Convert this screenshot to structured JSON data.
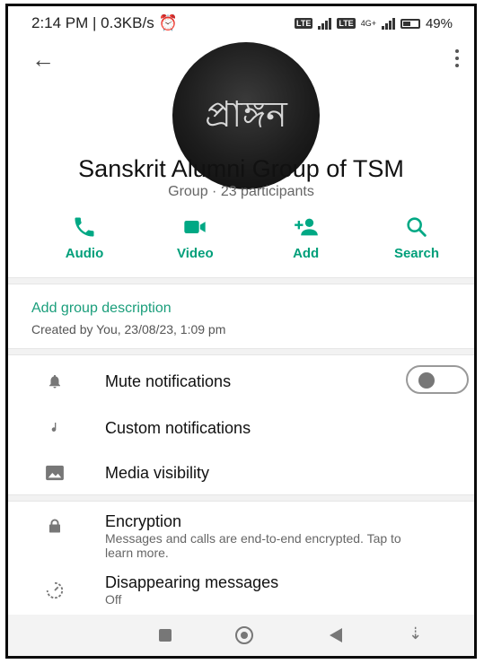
{
  "status": {
    "time_speed": "2:14 PM | 0.3KB/s",
    "network_label": "4G+",
    "battery": "49"
  },
  "group": {
    "avatar_text": "প্রাঙ্গন",
    "name": "Sanskrit Alumni Group of TSM",
    "meta": "Group · 23 participants"
  },
  "actions": [
    {
      "label": "Audio"
    },
    {
      "label": "Video"
    },
    {
      "label": "Add"
    },
    {
      "label": "Search"
    }
  ],
  "description": {
    "add_label": "Add group description",
    "created": "Created by You, 23/08/23, 1:09 pm"
  },
  "settings": {
    "mute": "Mute notifications",
    "custom": "Custom notifications",
    "media": "Media visibility",
    "encryption_title": "Encryption",
    "encryption_sub": "Messages and calls are end-to-end encrypted. Tap to learn more.",
    "disappearing_title": "Disappearing messages",
    "disappearing_sub": "Off"
  },
  "colors": {
    "accent": "#00a884",
    "accent_text": "#1a9e7b"
  },
  "icons": {
    "audio": "phone-icon",
    "video": "video-camera-icon",
    "add": "add-person-icon",
    "search": "search-icon"
  }
}
